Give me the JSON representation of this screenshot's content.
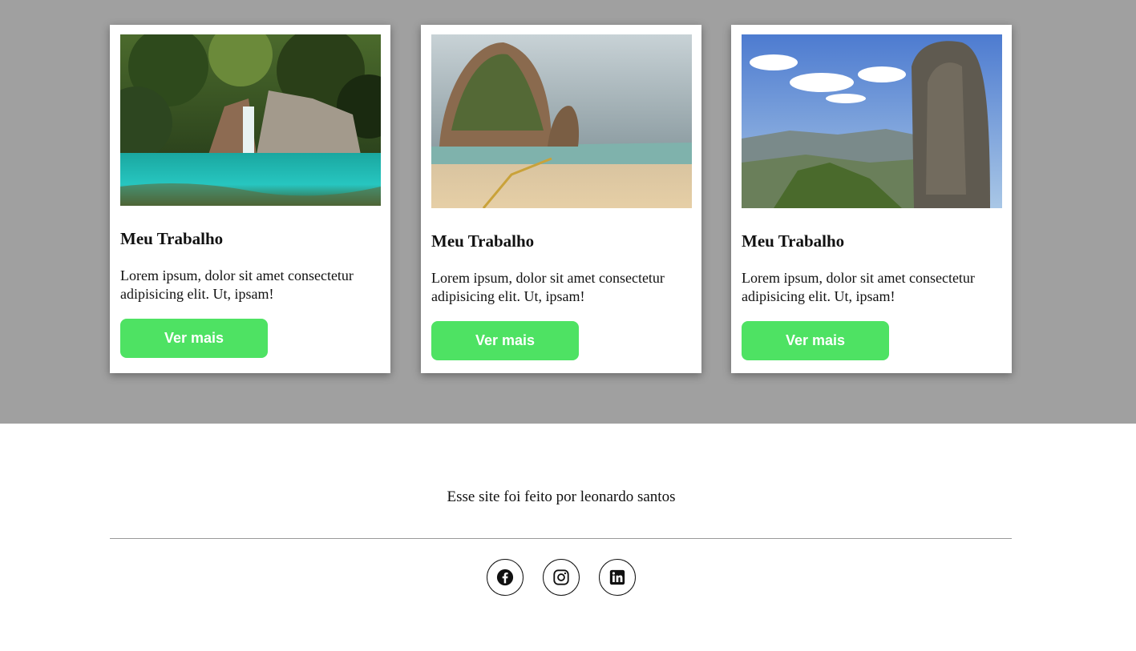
{
  "portfolio": {
    "cards": [
      {
        "image": "waterfall-lagoon-photo",
        "title": "Meu Trabalho",
        "text": "Lorem ipsum, dolor sit amet consectetur adipisicing elit. Ut, ipsam!",
        "button_label": "Ver mais"
      },
      {
        "image": "beach-rock-photo",
        "title": "Meu Trabalho",
        "text": "Lorem ipsum, dolor sit amet consectetur adipisicing elit. Ut, ipsam!",
        "button_label": "Ver mais"
      },
      {
        "image": "mountain-rock-photo",
        "title": "Meu Trabalho",
        "text": "Lorem ipsum, dolor sit amet consectetur adipisicing elit. Ut, ipsam!",
        "button_label": "Ver mais"
      }
    ]
  },
  "footer": {
    "credit": "Esse site foi feito por leonardo santos",
    "socials": [
      {
        "icon": "facebook-icon"
      },
      {
        "icon": "instagram-icon"
      },
      {
        "icon": "linkedin-icon"
      }
    ]
  },
  "colors": {
    "section_bg": "#a0a0a0",
    "button_bg": "#4ee263",
    "button_text": "#ffffff"
  }
}
